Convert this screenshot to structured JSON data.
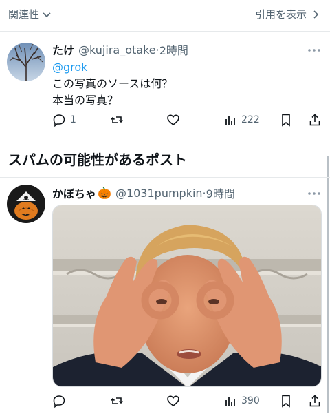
{
  "topbar": {
    "sort_label": "関連性",
    "quotes_label": "引用を表示"
  },
  "tweet1": {
    "name": "たけ",
    "handle": "@kujira_otake",
    "time": "2時間",
    "mention": "@grok",
    "line1": "この写真のソースは何？",
    "line2": "本当の写真？",
    "replies": "1",
    "views": "222"
  },
  "spam_section": {
    "title": "スパムの可能性があるポスト"
  },
  "tweet2": {
    "name": "かぼちゃ",
    "emoji": "🎃",
    "handle": "@1031pumpkin",
    "time": "9時間",
    "views": "390"
  },
  "colors": {
    "accent": "#1d9bf0",
    "muted": "#536471",
    "text": "#0f1419"
  },
  "icons": [
    "chevron-down-icon",
    "chevron-right-icon",
    "more-icon",
    "reply-icon",
    "retweet-icon",
    "like-icon",
    "views-icon",
    "bookmark-icon",
    "share-icon"
  ]
}
